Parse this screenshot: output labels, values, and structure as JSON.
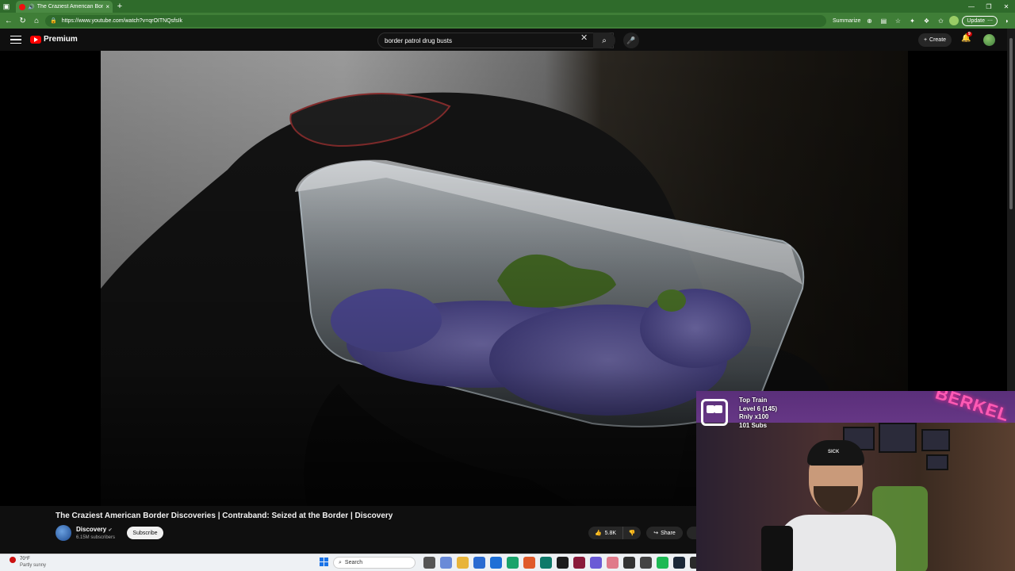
{
  "browser": {
    "tab_title": "The Craziest American Border",
    "url": "https://www.youtube.com/watch?v=qrOITNQsfsIk",
    "summarize_label": "Summarize",
    "update_label": "Update",
    "tab_close": "×",
    "new_tab": "+"
  },
  "youtube": {
    "logo_text": "Premium",
    "search_query": "border patrol drug busts",
    "create_label": "Create",
    "notif_count": "9"
  },
  "video": {
    "title": "The Craziest American Border Discoveries | Contraband: Seized at the Border | Discovery",
    "channel": "Discovery",
    "subscribers": "6.15M subscribers",
    "subscribe_label": "Subscribe",
    "likes": "5.8K",
    "share_label": "Share"
  },
  "overlay": {
    "train_title": "Top Train",
    "train_level": "Level 6  (145)",
    "train_user": "Rnly x100",
    "train_subs": "101 Subs",
    "neon_text": "BERKEL"
  },
  "taskbar": {
    "temperature": "70°F",
    "weather": "Partly sunny",
    "search_placeholder": "Search"
  },
  "colors": {
    "chrome_green": "#3f7e37",
    "yt_red": "#ff0000",
    "neon_pink": "#ff5ab4"
  }
}
